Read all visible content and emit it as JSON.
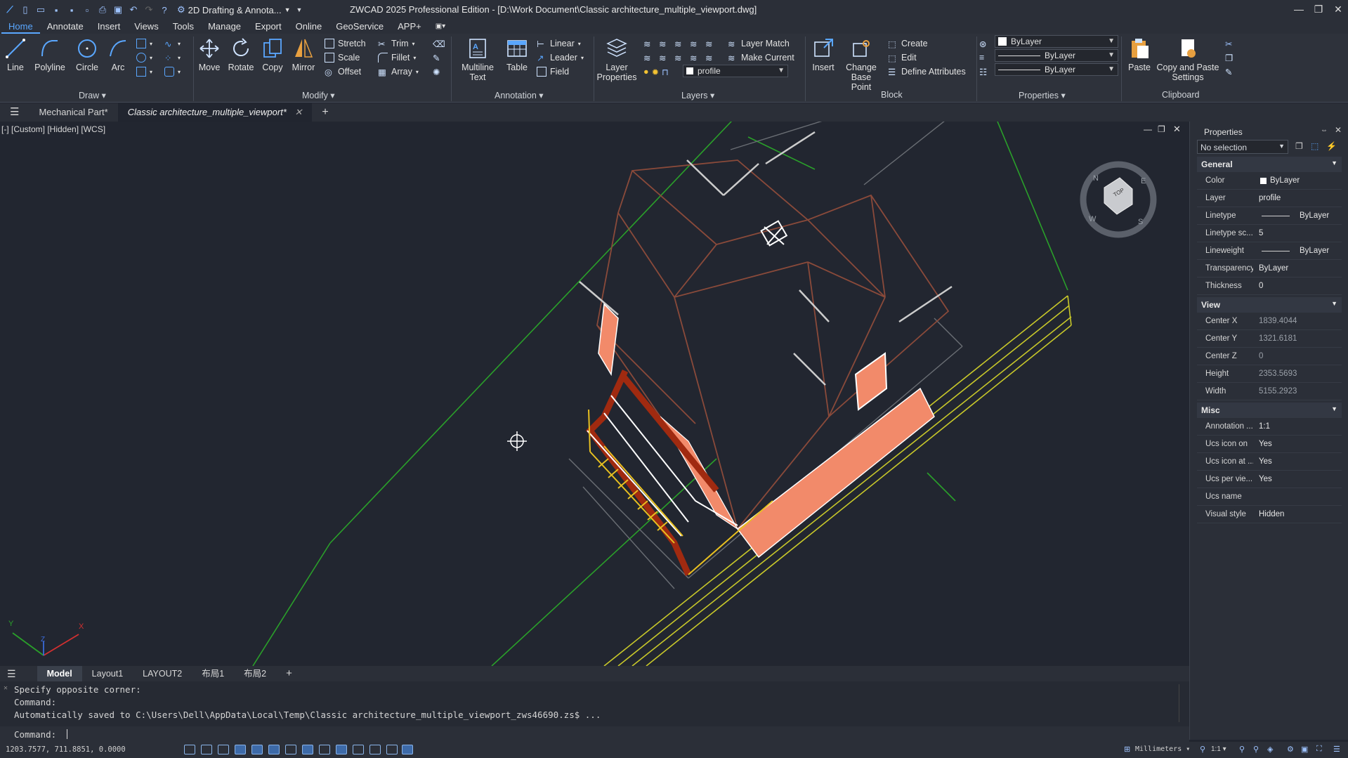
{
  "titlebar": {
    "workspace": "2D Drafting & Annota...",
    "title": "ZWCAD 2025 Professional Edition - [D:\\Work Document\\Classic architecture_multiple_viewport.dwg]"
  },
  "menu": {
    "tabs": [
      "Home",
      "Annotate",
      "Insert",
      "Views",
      "Tools",
      "Manage",
      "Export",
      "Online",
      "GeoService",
      "APP+"
    ],
    "active": "Home"
  },
  "ribbon": {
    "draw": {
      "line": "Line",
      "polyline": "Polyline",
      "circle": "Circle",
      "arc": "Arc",
      "panel": "Draw"
    },
    "modify": {
      "move": "Move",
      "rotate": "Rotate",
      "copy": "Copy",
      "mirror": "Mirror",
      "stretch": "Stretch",
      "scale": "Scale",
      "offset": "Offset",
      "trim": "Trim",
      "fillet": "Fillet",
      "array": "Array",
      "panel": "Modify"
    },
    "annotation": {
      "mtext_1": "Multiline",
      "mtext_2": "Text",
      "table": "Table",
      "linear": "Linear",
      "leader": "Leader",
      "field": "Field",
      "panel": "Annotation"
    },
    "layers": {
      "layer_props_1": "Layer",
      "layer_props_2": "Properties",
      "layer_match": "Layer Match",
      "make_current": "Make Current",
      "current_layer": "profile",
      "panel": "Layers"
    },
    "block": {
      "insert": "Insert",
      "change_base_1": "Change",
      "change_base_2": "Base Point",
      "create": "Create",
      "edit": "Edit",
      "define_attributes": "Define Attributes",
      "panel": "Block"
    },
    "properties": {
      "color": "ByLayer",
      "linetype": "ByLayer",
      "lineweight": "ByLayer",
      "panel": "Properties"
    },
    "clipboard": {
      "paste": "Paste",
      "copy_paste_1": "Copy and Paste",
      "copy_paste_2": "Settings",
      "panel": "Clipboard"
    }
  },
  "doc_tabs": [
    "Mechanical Part*",
    "Classic architecture_multiple_viewport*"
  ],
  "viewport": {
    "label": "[-] [Custom] [Hidden] [WCS]",
    "viewcube_top": "TOP",
    "compass": {
      "n": "N",
      "e": "E",
      "s": "S",
      "w": "W"
    },
    "ucs": {
      "x": "X",
      "y": "Y",
      "z": "Z"
    }
  },
  "properties_panel": {
    "title": "Properties",
    "selection": "No selection",
    "general": {
      "title": "General",
      "rows": [
        {
          "k": "Color",
          "v": "ByLayer"
        },
        {
          "k": "Layer",
          "v": "profile"
        },
        {
          "k": "Linetype",
          "v": "ByLayer"
        },
        {
          "k": "Linetype sc...",
          "v": "5"
        },
        {
          "k": "Lineweight",
          "v": "ByLayer"
        },
        {
          "k": "Transparency",
          "v": "ByLayer"
        },
        {
          "k": "Thickness",
          "v": "0"
        }
      ]
    },
    "view": {
      "title": "View",
      "rows": [
        {
          "k": "Center X",
          "v": "1839.4044"
        },
        {
          "k": "Center Y",
          "v": "1321.6181"
        },
        {
          "k": "Center Z",
          "v": "0"
        },
        {
          "k": "Height",
          "v": "2353.5693"
        },
        {
          "k": "Width",
          "v": "5155.2923"
        }
      ]
    },
    "misc": {
      "title": "Misc",
      "rows": [
        {
          "k": "Annotation ...",
          "v": "1:1"
        },
        {
          "k": "Ucs icon on",
          "v": "Yes"
        },
        {
          "k": "Ucs icon at ...",
          "v": "Yes"
        },
        {
          "k": "Ucs per vie...",
          "v": "Yes"
        },
        {
          "k": "Ucs name",
          "v": ""
        },
        {
          "k": "Visual style",
          "v": "Hidden"
        }
      ]
    }
  },
  "layout_tabs": [
    "Model",
    "Layout1",
    "LAYOUT2",
    "布局1",
    "布局2"
  ],
  "command": {
    "lines": [
      "Specify opposite corner:",
      "Command:",
      "Automatically saved to C:\\Users\\Dell\\AppData\\Local\\Temp\\Classic architecture_multiple_viewport_zws46690.zs$ ..."
    ],
    "prompt": "Command:"
  },
  "status": {
    "coords": "1203.7577, 711.8851, 0.0000",
    "units": "Millimeters",
    "scale": "1:1"
  },
  "colors": {
    "background": "#222630",
    "roof": "#8a4a3a",
    "brick": "#f28a6a",
    "ground_line": "#2aa02a",
    "road": "#c8c82a"
  }
}
